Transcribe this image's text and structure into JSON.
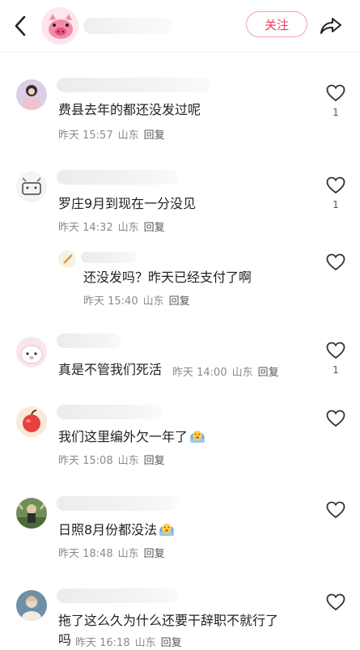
{
  "header": {
    "follow_label": "关注"
  },
  "comments": [
    {
      "text": "费县去年的都还没发过呢",
      "time": "昨天 15:57",
      "location": "山东",
      "reply": "回复",
      "likes": "1"
    },
    {
      "text": "罗庄9月到现在一分没见",
      "time": "昨天 14:32",
      "location": "山东",
      "reply": "回复",
      "likes": "1"
    },
    {
      "text": "还没发吗？昨天已经支付了啊",
      "time": "昨天 15:40",
      "location": "山东",
      "reply": "回复",
      "likes": ""
    },
    {
      "text": "真是不管我们死活",
      "time": "昨天 14:00",
      "location": "山东",
      "reply": "回复",
      "likes": "1"
    },
    {
      "text": "我们这里编外欠一年了",
      "time": "昨天 15:08",
      "location": "山东",
      "reply": "回复",
      "likes": ""
    },
    {
      "text": "日照8月份都没法",
      "time": "昨天 18:48",
      "location": "山东",
      "reply": "回复",
      "likes": ""
    },
    {
      "text_line1": "拖了这么久为什么还要干辞职不就行了",
      "text_line2": "吗",
      "time": "昨天 16:18",
      "location": "山东",
      "reply": "回复",
      "likes": ""
    }
  ],
  "icons": [
    "back-arrow-icon",
    "share-icon",
    "heart-outline-icon",
    "crying-emoji-icon"
  ],
  "colors": {
    "accent": "#ee3b58",
    "follow_border": "#f4a0ad",
    "meta": "#8a8a8a"
  }
}
